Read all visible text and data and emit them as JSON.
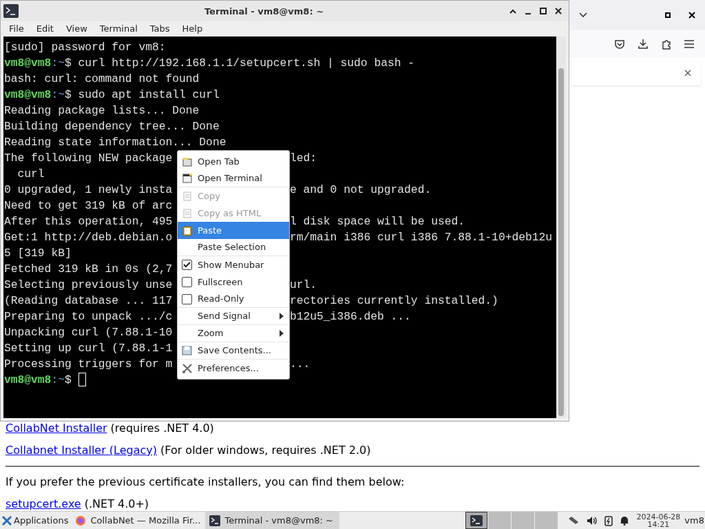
{
  "browser": {
    "page": [
      {
        "kind": "link_line",
        "link": "CollabNet Installer",
        "text": "(requires .NET 4.0)"
      },
      {
        "kind": "link_line",
        "link": "Collabnet Installer (Legacy)",
        "text": "(For older windows, requires .NET 2.0)"
      },
      {
        "kind": "rule"
      },
      {
        "kind": "paragraph",
        "text": "If you prefer the previous certificate installers, you can find them below:"
      },
      {
        "kind": "link_line",
        "link": "setupcert.exe",
        "text": "(.NET 4.0+)"
      }
    ]
  },
  "terminal": {
    "title": "Terminal - vm8@vm8: ~",
    "menubar": [
      "File",
      "Edit",
      "View",
      "Terminal",
      "Tabs",
      "Help"
    ],
    "lines": [
      {
        "kind": "output",
        "text": "[sudo] password for vm8:"
      },
      {
        "kind": "command",
        "user": "vm8@vm8",
        "path": ":~",
        "sign": "$",
        "text": "curl http://192.168.1.1/setupcert.sh | sudo bash -"
      },
      {
        "kind": "output",
        "text": "bash: curl: command not found"
      },
      {
        "kind": "command",
        "user": "vm8@vm8",
        "path": ":~",
        "sign": "$",
        "text": "sudo apt install curl"
      },
      {
        "kind": "output",
        "text": "Reading package lists... Done"
      },
      {
        "kind": "output",
        "text": "Building dependency tree... Done"
      },
      {
        "kind": "output",
        "text": "Reading state information... Done"
      },
      {
        "kind": "output",
        "text": "The following NEW package",
        "right": "led:"
      },
      {
        "kind": "output",
        "text": "  curl"
      },
      {
        "kind": "output",
        "text": "0 upgraded, 1 newly insta",
        "right": "e and 0 not upgraded."
      },
      {
        "kind": "output",
        "text": "Need to get 319 kB of arc"
      },
      {
        "kind": "output",
        "text": "After this operation, 495",
        "right": "l disk space will be used."
      },
      {
        "kind": "output",
        "text": "Get:1 http://deb.debian.o",
        "right": "rm/main i386 curl i386 7.88.1-10+deb12u"
      },
      {
        "kind": "output",
        "text": "5 [319 kB]"
      },
      {
        "kind": "output",
        "text": "Fetched 319 kB in 0s (2,7"
      },
      {
        "kind": "output",
        "text": "Selecting previously unse",
        "right": "url."
      },
      {
        "kind": "output",
        "text": "(Reading database ... 117",
        "right": "rectories currently installed.)"
      },
      {
        "kind": "output",
        "text": "Preparing to unpack .../c",
        "right": "b12u5_i386.deb ..."
      },
      {
        "kind": "output",
        "text": "Unpacking curl (7.88.1-10"
      },
      {
        "kind": "output",
        "text": "Setting up curl (7.88.1-1"
      },
      {
        "kind": "output",
        "text": "Processing triggers for m",
        "right": "..."
      },
      {
        "kind": "input",
        "user": "vm8@vm8",
        "path": ":~",
        "sign": "$"
      }
    ]
  },
  "context_menu": [
    {
      "kind": "icon",
      "label": "Open Tab",
      "disabled": false,
      "selected": false,
      "separator_after": false
    },
    {
      "kind": "icon",
      "label": "Open Terminal",
      "disabled": false,
      "selected": false,
      "separator_after": true
    },
    {
      "kind": "icon",
      "label": "Copy",
      "disabled": true,
      "selected": false,
      "separator_after": false
    },
    {
      "kind": "icon",
      "label": "Copy as HTML",
      "disabled": true,
      "selected": false,
      "separator_after": false
    },
    {
      "kind": "icon",
      "label": "Paste",
      "disabled": false,
      "selected": true,
      "separator_after": false
    },
    {
      "kind": "plain",
      "label": "Paste Selection",
      "disabled": false,
      "selected": false,
      "separator_after": true
    },
    {
      "kind": "check",
      "label": "Show Menubar",
      "checked": true,
      "disabled": false,
      "selected": false,
      "separator_after": false
    },
    {
      "kind": "check",
      "label": "Fullscreen",
      "checked": false,
      "disabled": false,
      "selected": false,
      "separator_after": false
    },
    {
      "kind": "check",
      "label": "Read-Only",
      "checked": false,
      "disabled": false,
      "selected": false,
      "separator_after": true
    },
    {
      "kind": "submenu",
      "label": "Send Signal",
      "disabled": false,
      "selected": false,
      "separator_after": true
    },
    {
      "kind": "submenu",
      "label": "Zoom",
      "disabled": false,
      "selected": false,
      "separator_after": true
    },
    {
      "kind": "icon",
      "label": "Save Contents...",
      "disabled": false,
      "selected": false,
      "separator_after": true
    },
    {
      "kind": "icon",
      "label": "Preferences...",
      "disabled": false,
      "selected": false,
      "separator_after": false
    }
  ],
  "taskbar": {
    "applications": "Applications",
    "tasks": [
      {
        "label": "CollabNet — Mozilla Fir...",
        "selected": false
      },
      {
        "label": "Terminal - vm8@vm8: ~",
        "selected": true
      }
    ],
    "date": "2024-06-28",
    "time": "14:21",
    "user": "vm8"
  }
}
